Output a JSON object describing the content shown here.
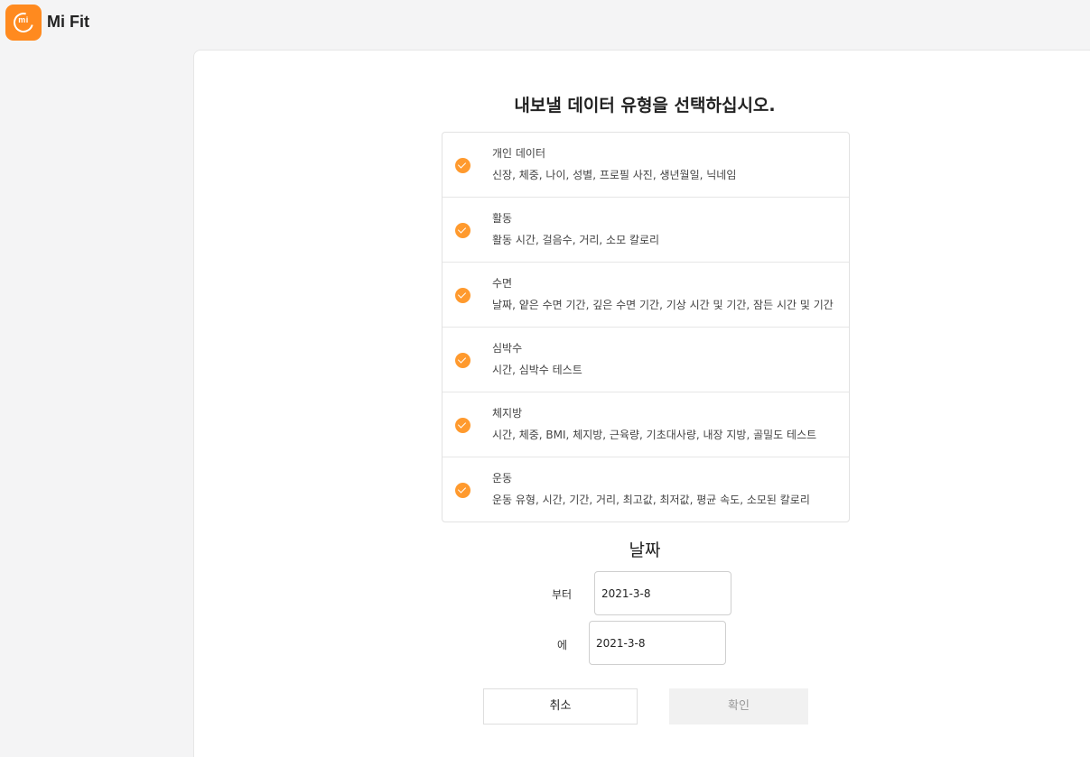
{
  "app": {
    "title": "Mi Fit",
    "logo_text": "mi"
  },
  "page": {
    "heading": "내보낼 데이터 유형을 선택하십시오."
  },
  "data_types": [
    {
      "title": "개인 데이터",
      "description": "신장, 체중, 나이, 성별, 프로필 사진, 생년월일, 닉네임",
      "checked": true
    },
    {
      "title": "활동",
      "description": "활동 시간, 걸음수, 거리, 소모 칼로리",
      "checked": true
    },
    {
      "title": "수면",
      "description": "날짜, 얕은 수면 기간, 깊은 수면 기간, 기상 시간 및 기간, 잠든 시간 및 기간",
      "checked": true
    },
    {
      "title": "심박수",
      "description": "시간, 심박수 테스트",
      "checked": true
    },
    {
      "title": "체지방",
      "description": "시간, 체중, BMI, 체지방, 근육량, 기초대사량, 내장 지방, 골밀도 테스트",
      "checked": true
    },
    {
      "title": "운동",
      "description": "운동 유형, 시간, 기간, 거리, 최고값, 최저값, 평균 속도, 소모된 칼로리",
      "checked": true
    }
  ],
  "date": {
    "title": "날짜",
    "from_label": "부터",
    "from_value": "2021-3-8",
    "to_label": "에",
    "to_value": "2021-3-8"
  },
  "buttons": {
    "cancel": "취소",
    "confirm": "확인"
  },
  "colors": {
    "accent": "#ff9a2e",
    "logo": "#ff8a1f"
  }
}
